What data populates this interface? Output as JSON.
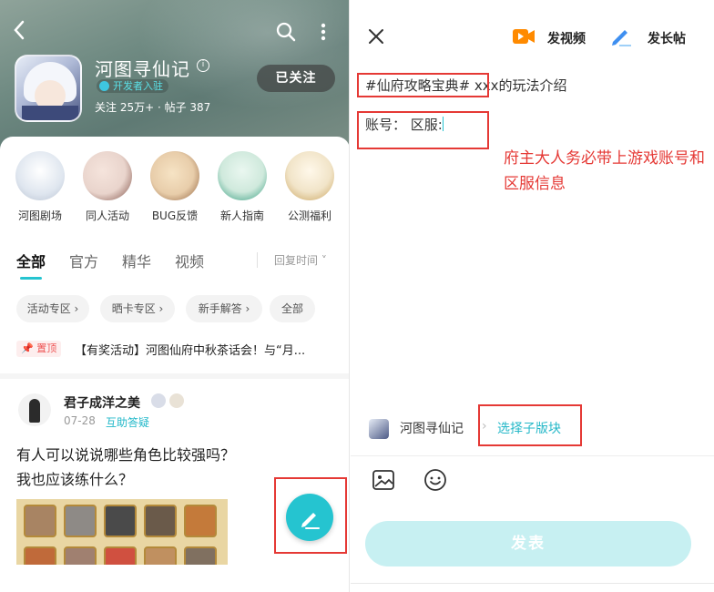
{
  "left": {
    "header": {
      "back_icon": "chevron-left-icon",
      "search_icon": "search-icon",
      "more_icon": "more-vertical-icon"
    },
    "game": {
      "title": "河图寻仙记",
      "info_glyph": "i",
      "badge": "开发者入驻",
      "stats": "关注 25万+ · 帖子 387",
      "follow_label": "已关注"
    },
    "categories": [
      {
        "label": "河图剧场",
        "color": "#dfe6ef"
      },
      {
        "label": "同人活动",
        "color": "#e9d4cc"
      },
      {
        "label": "BUG反馈",
        "color": "#e8cdaa"
      },
      {
        "label": "新人指南",
        "color": "#cfe9dc"
      },
      {
        "label": "公测福利",
        "color": "#f1e4c8"
      }
    ],
    "tabs": [
      "全部",
      "官方",
      "精华",
      "视频"
    ],
    "sort_label": "回复时间 ˅",
    "chips": [
      "活动专区 ›",
      "晒卡专区 ›",
      "新手解答 ›",
      "全部"
    ],
    "pinned": {
      "badge": "📌 置顶",
      "text": "【有奖活动】河图仙府中秋茶话会！与“月..."
    },
    "post": {
      "author": "君子成洋之美",
      "date": "07-28",
      "topic": "互助答疑",
      "line1": "有人可以说说哪些角色比较强吗？",
      "line2": "我也应该练什么？"
    },
    "fab_icon": "pen-icon"
  },
  "right": {
    "close_icon": "close-icon",
    "video_label": "发视频",
    "article_label": "发长帖",
    "title_tag": "#仙府攻略宝典#",
    "title_rest": " xxx的玩法介绍",
    "body_text": "账号：  区服:",
    "note": "府主大人务必带上游戏账号和区服信息",
    "board_name": "河图寻仙记",
    "board_arrow": "›",
    "board_select": "选择子版块",
    "submit_label": "发表",
    "colors": {
      "accent": "#25c4d0",
      "highlight_box": "#e53935",
      "submit_disabled": "#c7f0f2"
    }
  }
}
